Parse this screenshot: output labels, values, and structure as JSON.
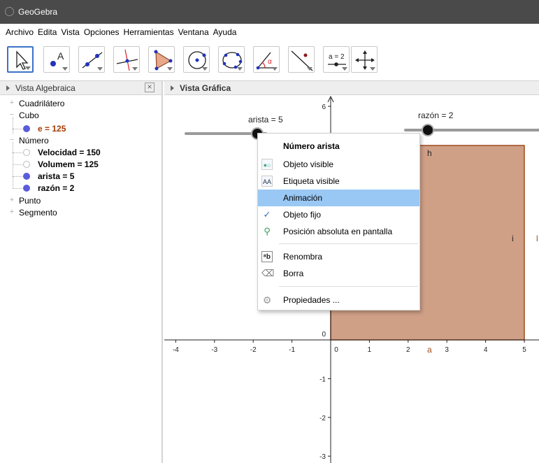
{
  "window": {
    "title": "GeoGebra"
  },
  "menubar": [
    "Archivo",
    "Edita",
    "Vista",
    "Opciones",
    "Herramientas",
    "Ventana",
    "Ayuda"
  ],
  "toolbar": {
    "tools": [
      {
        "icon": "move-pointer-icon",
        "active": true
      },
      {
        "icon": "new-point-icon",
        "label": "A"
      },
      {
        "icon": "line-through-two-points-icon"
      },
      {
        "icon": "perpendicular-line-icon"
      },
      {
        "icon": "polygon-icon"
      },
      {
        "icon": "circle-center-point-icon"
      },
      {
        "icon": "conic-five-points-icon"
      },
      {
        "icon": "angle-icon",
        "label": "α"
      },
      {
        "icon": "reflect-about-line-icon"
      },
      {
        "icon": "slider-icon",
        "label": "a = 2"
      },
      {
        "icon": "move-graphics-view-icon"
      }
    ]
  },
  "algebra_view": {
    "title": "Vista Algebraica",
    "groups": {
      "cuadrilatero": "Cuadrilátero",
      "cubo": "Cubo",
      "cubo_e": "e = 125",
      "numero": "Número",
      "velocidad": "Velocidad = 150",
      "volumem": "Volumem = 125",
      "arista": "arista = 5",
      "razon": "razón = 2",
      "punto": "Punto",
      "segmento": "Segmento"
    },
    "colors": {
      "dot": "#5b5bdd",
      "cube_value": "#a63a00"
    }
  },
  "graphics_view": {
    "title": "Vista Gráfica",
    "x_ticks": [
      "-4",
      "-3",
      "-2",
      "-1",
      "0",
      "1",
      "2",
      "3",
      "4",
      "5"
    ],
    "y_ticks": [
      "6",
      "0",
      "-1",
      "-2",
      "-3"
    ],
    "sliders": [
      {
        "label": "arista = 5",
        "value": 5
      },
      {
        "label": "razón = 2",
        "value": 2
      }
    ],
    "square": {
      "fill": "#cf9f86",
      "stroke": "#a04b1e"
    },
    "point_labels": {
      "h": "h",
      "i": "i",
      "a": "a"
    }
  },
  "context_menu": {
    "title": "Número arista",
    "items": [
      {
        "label": "Objeto visible",
        "icon": "object-visible-icon"
      },
      {
        "label": "Etiqueta visible",
        "icon": "label-visible-icon"
      },
      {
        "label": "Animación",
        "icon": "",
        "highlighted": true
      },
      {
        "label": "Objeto fijo",
        "icon": "checkmark-icon"
      },
      {
        "label": "Posición absoluta en pantalla",
        "icon": "pin-icon"
      },
      {
        "label": "Renombra",
        "icon": "rename-icon"
      },
      {
        "label": "Borra",
        "icon": "eraser-icon"
      },
      {
        "label": "Propiedades ...",
        "icon": "gear-icon"
      }
    ],
    "highlight_color": "#99c8f4"
  }
}
